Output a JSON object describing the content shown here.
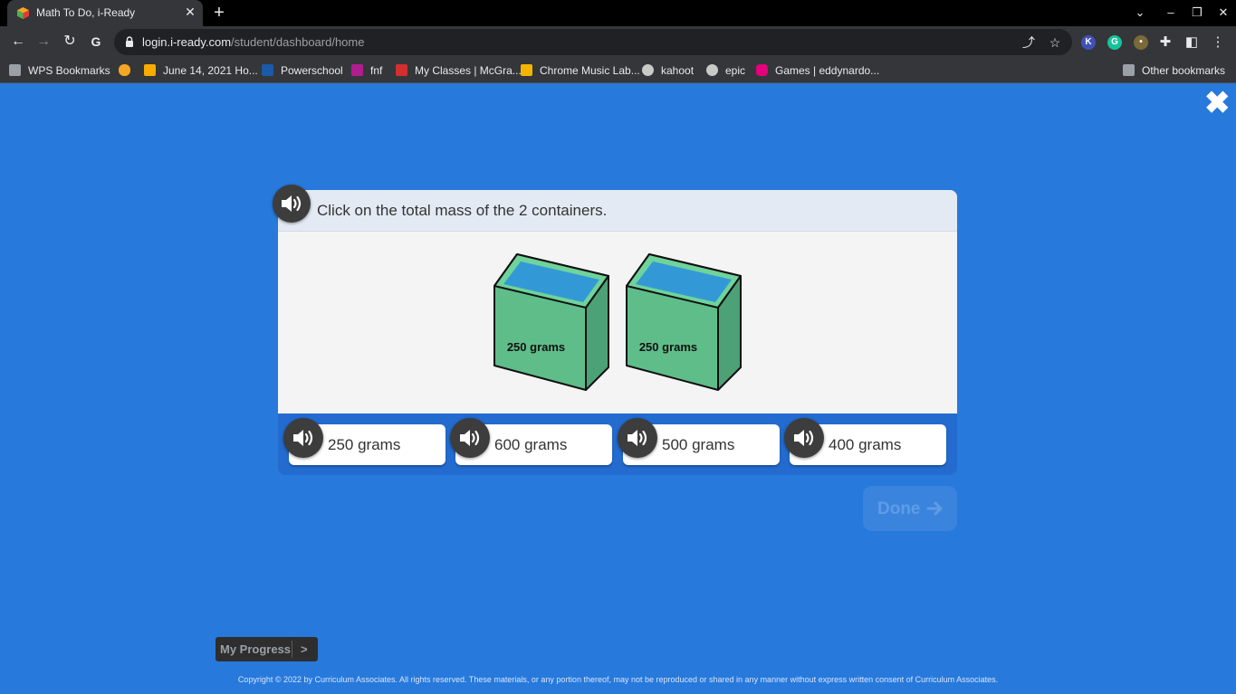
{
  "browser": {
    "tab_title": "Math To Do, i-Ready",
    "url_host": "login.i-ready.com",
    "url_path": "/student/dashboard/home"
  },
  "bookmarks": [
    {
      "label": "WPS Bookmarks",
      "icon": "folder-icon",
      "color": "#9aa0a6"
    },
    {
      "label": "",
      "icon": "hand-icon",
      "color": "#f5a623"
    },
    {
      "label": "June 14, 2021 Ho...",
      "icon": "classroom-icon",
      "color": "#f9ab00"
    },
    {
      "label": "Powerschool",
      "icon": "sis-icon",
      "color": "#1a5aa8"
    },
    {
      "label": "fnf",
      "icon": "fnf-icon",
      "color": "#b01e8e"
    },
    {
      "label": "My Classes | McGra...",
      "icon": "mcgraw-icon",
      "color": "#d32f2f"
    },
    {
      "label": "Chrome Music Lab...",
      "icon": "music-lab-icon",
      "color": "#f4b400"
    },
    {
      "label": "kahoot",
      "icon": "globe-icon",
      "color": "#c9c9c9"
    },
    {
      "label": "epic",
      "icon": "globe-icon",
      "color": "#c9c9c9"
    },
    {
      "label": "Games | eddynardo...",
      "icon": "games-icon",
      "color": "#e4007c"
    }
  ],
  "other_bookmarks": "Other bookmarks",
  "lesson": {
    "question": "Click on the total mass of the 2 containers.",
    "containers": [
      {
        "label": "250 grams"
      },
      {
        "label": "250 grams"
      }
    ],
    "answers": [
      {
        "label": "250 grams"
      },
      {
        "label": "600 grams"
      },
      {
        "label": "500 grams"
      },
      {
        "label": "400 grams"
      }
    ],
    "done_label": "Done"
  },
  "footer": {
    "progress_label": "My Progress",
    "progress_chevron": ">",
    "copyright": "Copyright © 2022 by Curriculum Associates. All rights reserved. These materials, or any portion thereof, may not be reproduced or shared in any manner without express written consent of Curriculum Associates."
  },
  "colors": {
    "background": "#2879dc",
    "container_green": "#5fbd8a",
    "container_water": "#3399d6",
    "speaker": "#3d3d3d"
  }
}
